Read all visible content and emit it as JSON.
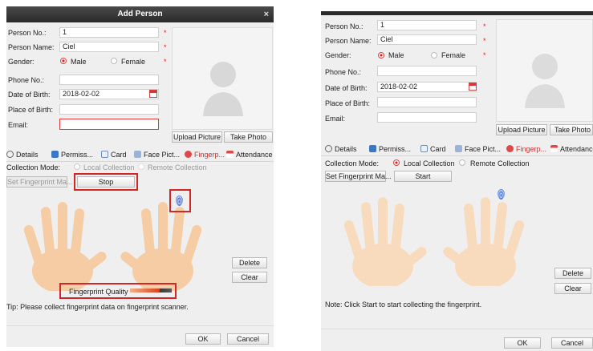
{
  "left": {
    "title": "Add Person",
    "close": "×",
    "labels": {
      "person_no": "Person No.:",
      "person_name": "Person Name:",
      "gender": "Gender:",
      "phone": "Phone No.:",
      "dob": "Date of Birth:",
      "pob": "Place of Birth:",
      "email": "Email:"
    },
    "values": {
      "person_no": "1",
      "person_name": "Ciel",
      "dob": "2018-02-02",
      "phone": "",
      "pob": "",
      "email": ""
    },
    "gender": {
      "male": "Male",
      "female": "Female",
      "selected": "male"
    },
    "required_mark": "*",
    "buttons": {
      "upload": "Upload Picture",
      "take_photo": "Take Photo",
      "set_fingerprint": "Set Fingerprint Ma...",
      "stop": "Stop",
      "delete": "Delete",
      "clear": "Clear",
      "ok": "OK",
      "cancel": "Cancel"
    },
    "tabs": [
      "Details",
      "Permiss...",
      "Card",
      "Face Pict...",
      "Fingerp...",
      "Attendance R..."
    ],
    "active_tab": "Fingerp...",
    "collection_mode_label": "Collection Mode:",
    "local_collection": "Local Collection",
    "remote_collection": "Remote Collection",
    "quality_label": "Fingerprint Quality",
    "tip": "Tip: Please collect fingerprint data on fingerprint scanner."
  },
  "right": {
    "labels": {
      "person_no": "Person No.:",
      "person_name": "Person Name:",
      "gender": "Gender:",
      "phone": "Phone No.:",
      "dob": "Date of Birth:",
      "pob": "Place of Birth:",
      "email": "Email:"
    },
    "values": {
      "person_no": "1",
      "person_name": "Ciel",
      "dob": "2018-02-02"
    },
    "gender": {
      "male": "Male",
      "female": "Female",
      "selected": "male"
    },
    "required_mark": "*",
    "buttons": {
      "upload": "Upload Picture",
      "take_photo": "Take Photo",
      "set_fingerprint": "Set Fingerprint Ma...",
      "start": "Start",
      "delete": "Delete",
      "clear": "Clear",
      "ok": "OK",
      "cancel": "Cancel"
    },
    "tabs": [
      "Details",
      "Permiss...",
      "Card",
      "Face Pict...",
      "Fingerp...",
      "Attendance R..."
    ],
    "active_tab": "Fingerp...",
    "collection_mode_label": "Collection Mode:",
    "local_collection": "Local Collection",
    "remote_collection": "Remote Collection",
    "note": "Note: Click Start to start collecting the fingerprint."
  },
  "icons": [
    "details-icon",
    "permission-icon",
    "card-icon",
    "face-picture-icon",
    "fingerprint-icon",
    "attendance-icon",
    "calendar-icon",
    "person-silhouette-icon",
    "hand-icon"
  ],
  "colors": {
    "accent_red": "#d32626",
    "title_bar": "#333333",
    "panel_bg": "#efefef",
    "hands": "#f6c89a"
  }
}
